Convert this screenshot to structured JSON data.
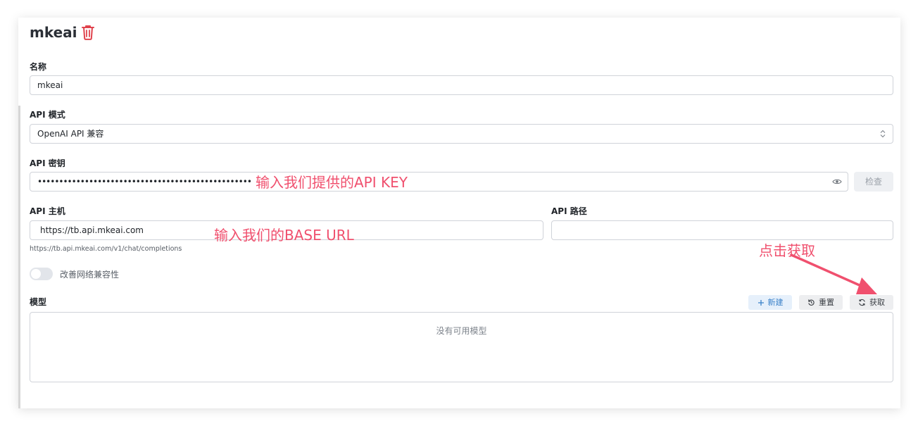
{
  "header": {
    "title": "mkeai",
    "delete_icon": "trash-icon"
  },
  "form": {
    "name": {
      "label": "名称",
      "value": "mkeai"
    },
    "api_mode": {
      "label": "API 模式",
      "value": "OpenAI API 兼容"
    },
    "api_key": {
      "label": "API 密钥",
      "value": "••••••••••••••••••••••••••••••••••••••••••••••••••",
      "check_label": "检查"
    },
    "api_host": {
      "label": "API 主机",
      "value": "https://tb.api.mkeai.com",
      "hint": "https://tb.api.mkeai.com/v1/chat/completions"
    },
    "api_path": {
      "label": "API 路径",
      "value": ""
    },
    "network_compat": {
      "label": "改善网络兼容性",
      "enabled": false
    }
  },
  "models": {
    "label": "模型",
    "new_label": "新建",
    "reset_label": "重置",
    "fetch_label": "获取",
    "empty_text": "没有可用模型"
  },
  "annotations": {
    "api_key_note": "输入我们提供的API KEY",
    "base_url_note": "输入我们的BASE URL",
    "fetch_note": "点击获取",
    "color": "#f0506e"
  },
  "colors": {
    "accent_blue": "#3b82c9",
    "danger": "#e0434d"
  }
}
